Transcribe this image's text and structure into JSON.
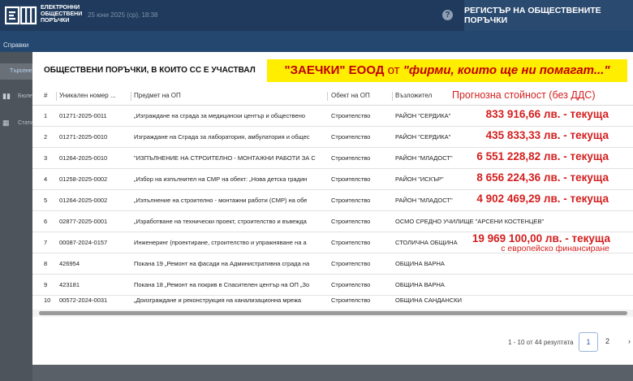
{
  "header": {
    "logo_lines": [
      "ЕЛЕКТРОННИ",
      "ОБЩЕСТВЕНИ",
      "ПОРЪЧКИ"
    ],
    "date": "25 юни 2025 (ср), 18:38",
    "help_icon": "?",
    "registry_button": "РЕГИСТЪР НА ОБЩЕСТВЕНИТЕ ПОРЪЧКИ"
  },
  "subbar": {
    "label": "Справки"
  },
  "sidebar": {
    "items": [
      {
        "label": "Търсене",
        "icon": "search-icon",
        "glyph": ""
      },
      {
        "label": "Бюлетини",
        "icon": "bar-chart-icon",
        "glyph": "▮▮"
      },
      {
        "label": "Статистика",
        "icon": "table-icon",
        "glyph": "▦"
      }
    ]
  },
  "modal": {
    "title": "ОБЩЕСТВЕНИ ПОРЪЧКИ, В КОИТО СС Е УЧАСТВАЛ",
    "banner": {
      "part1": "\"ЗАЕЧКИ\" ЕООД",
      "part2": "от",
      "part3": "\"фирми, които ще ни помагат...\""
    },
    "forecast_label": "Прогнозна стойност (без ДДС)",
    "columns": [
      "#",
      "Уникален номер ...",
      "Предмет на ОП",
      "Обект на ОП",
      "Възложител"
    ],
    "rows": [
      {
        "n": "1",
        "id": "01271-2025-0011",
        "subject": "„Изграждане на сграда за медицински център и обществено",
        "object": "Строителство",
        "authority": "РАЙОН \"СЕРДИКА\"",
        "value": "833 916,66 лв. - текуща"
      },
      {
        "n": "2",
        "id": "01271-2025-0010",
        "subject": "Изграждане на Сграда за лаборатория, амбулатория и общес",
        "object": "Строителство",
        "authority": "РАЙОН \"СЕРДИКА\"",
        "value": "435 833,33 лв. - текуща"
      },
      {
        "n": "3",
        "id": "01264-2025-0010",
        "subject": "\"ИЗПЪЛНЕНИЕ НА СТРОИТЕЛНО - МОНТАЖНИ РАБОТИ ЗА С",
        "object": "Строителство",
        "authority": "РАЙОН \"МЛАДОСТ\"",
        "value": "6 551 228,82 лв. - текуща"
      },
      {
        "n": "4",
        "id": "01258-2025-0002",
        "subject": "„Избор на изпълнител на СМР на обект: „Нова детска градин",
        "object": "Строителство",
        "authority": "РАЙОН \"ИСКЪР\"",
        "value": "8 656 224,36 лв. - текуща"
      },
      {
        "n": "5",
        "id": "01264-2025-0002",
        "subject": "„Изпълнение на строително - монтажни работи (СМР) на обе",
        "object": "Строителство",
        "authority": "РАЙОН \"МЛАДОСТ\"",
        "value": "4 902 469,29 лв. - текуща"
      },
      {
        "n": "6",
        "id": "02877-2025-0001",
        "subject": "„Изработване на технически проект, строителство и въвежда",
        "object": "Строителство",
        "authority": "ОСМО СРЕДНО УЧИЛИЩЕ \"АРСЕНИ КОСТЕНЦЕВ\"",
        "value": ""
      },
      {
        "n": "7",
        "id": "00087-2024-0157",
        "subject": "Инженеринг (проектиране, строителство и упражняване на а",
        "object": "Строителство",
        "authority": "СТОЛИЧНА ОБЩИНА",
        "value": "19 969 100,00 лв. - текуща",
        "note": "с европейско финансиране"
      },
      {
        "n": "8",
        "id": "426954",
        "subject": "Покана 19 „Ремонт на фасади на Административна сграда на",
        "object": "Строителство",
        "authority": "ОБЩИНА ВАРНА",
        "value": ""
      },
      {
        "n": "9",
        "id": "423181",
        "subject": "Покана 18 „Ремонт на покрив в Спасителен център на ОП „Зо",
        "object": "Строителство",
        "authority": "ОБЩИНА ВАРНА",
        "value": ""
      },
      {
        "n": "10",
        "id": "00572-2024-0031",
        "subject": "„Доизграждане и реконструкция на канализационна мрежа",
        "object": "Строителство",
        "authority": "ОБЩИНА САНДАНСКИ",
        "value": ""
      }
    ],
    "pagination": {
      "summary": "1 - 10 от 44 резултата",
      "current": "1",
      "next_page": "2",
      "more": "›"
    }
  }
}
